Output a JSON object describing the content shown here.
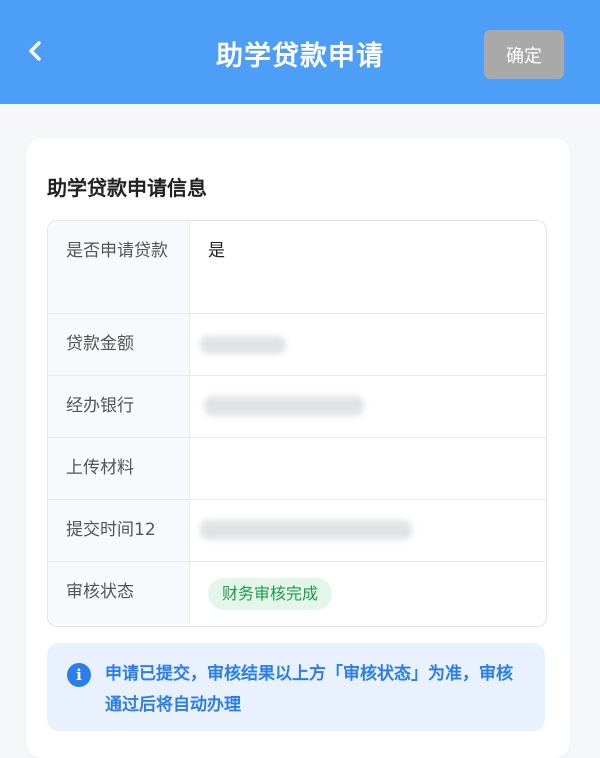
{
  "header": {
    "back_icon": "chevron-left-icon",
    "title": "助学贷款申请",
    "confirm_label": "确定"
  },
  "section": {
    "title": "助学贷款申请信息"
  },
  "fields": [
    {
      "label": "是否申请贷款",
      "value": "是"
    },
    {
      "label": "贷款金额",
      "value": ""
    },
    {
      "label": "经办银行",
      "value": ""
    },
    {
      "label": "上传材料",
      "value": ""
    },
    {
      "label": "提交时间12",
      "value": ""
    },
    {
      "label": "审核状态",
      "value": "财务审核完成"
    }
  ],
  "notice": {
    "icon": "info-icon",
    "text": "申请已提交，审核结果以上方「审核状态」为准，审核通过后将自动办理"
  },
  "colors": {
    "header_bg": "#4c9ef6",
    "confirm_bg": "#a9a9a9",
    "status_green": "#1e9c4b",
    "notice_blue": "#2c7ee8"
  }
}
